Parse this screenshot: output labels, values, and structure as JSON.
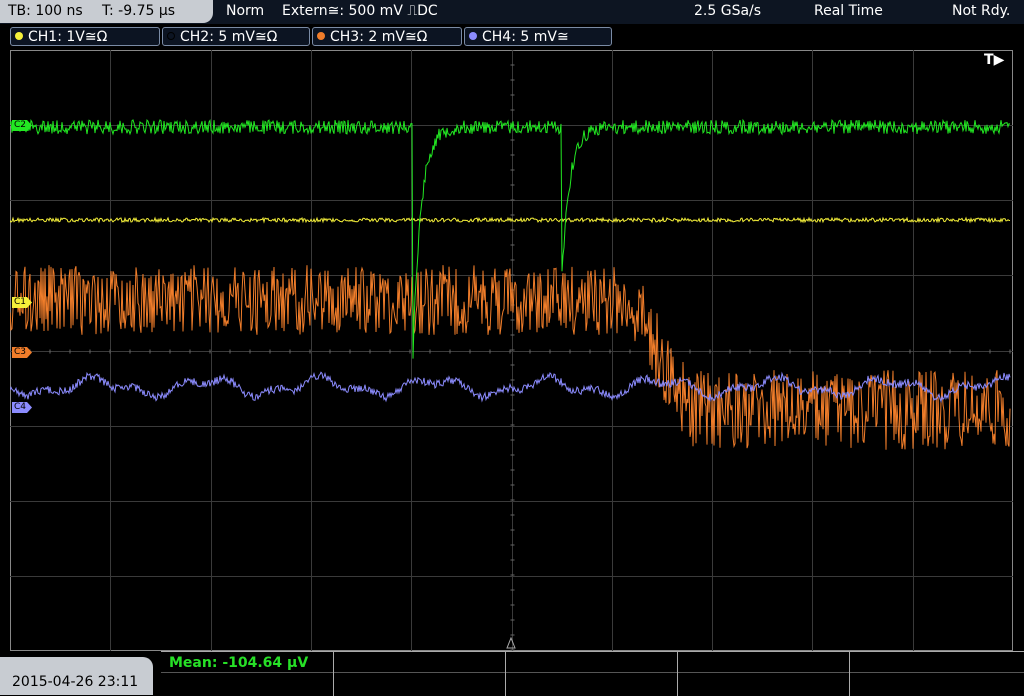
{
  "top_bar": {
    "timebase": "TB: 100 ns",
    "trigger_time": "T: -9.75 µs",
    "mode": "Norm",
    "trigger_source": "Extern≅: 500 mV ⎍DC",
    "sample_rate": "2.5 GSa/s",
    "acquisition": "Real Time",
    "status": "Not Rdy."
  },
  "channels": [
    {
      "label": "CH1: 1V≅Ω",
      "color": "#f5f03a",
      "active": false
    },
    {
      "label": "CH2: 5 mV≅Ω",
      "color": "#22e822",
      "active": true
    },
    {
      "label": "CH3: 2 mV≅Ω",
      "color": "#f07d2a",
      "active": false
    },
    {
      "label": "CH4: 5 mV≅",
      "color": "#8c8cff",
      "active": false
    }
  ],
  "markers": {
    "c1": "C1",
    "c2": "C2",
    "c3": "C3",
    "c4": "C4",
    "trigger": "T"
  },
  "colors": {
    "ch1": "#f5f03a",
    "ch2": "#22e822",
    "ch3": "#f07d2a",
    "ch4": "#8c8cff",
    "grid": "#3a3a3a"
  },
  "footer": {
    "datetime": "2015-04-26 23:11",
    "measurement": "Mean: -104.64 µV"
  }
}
